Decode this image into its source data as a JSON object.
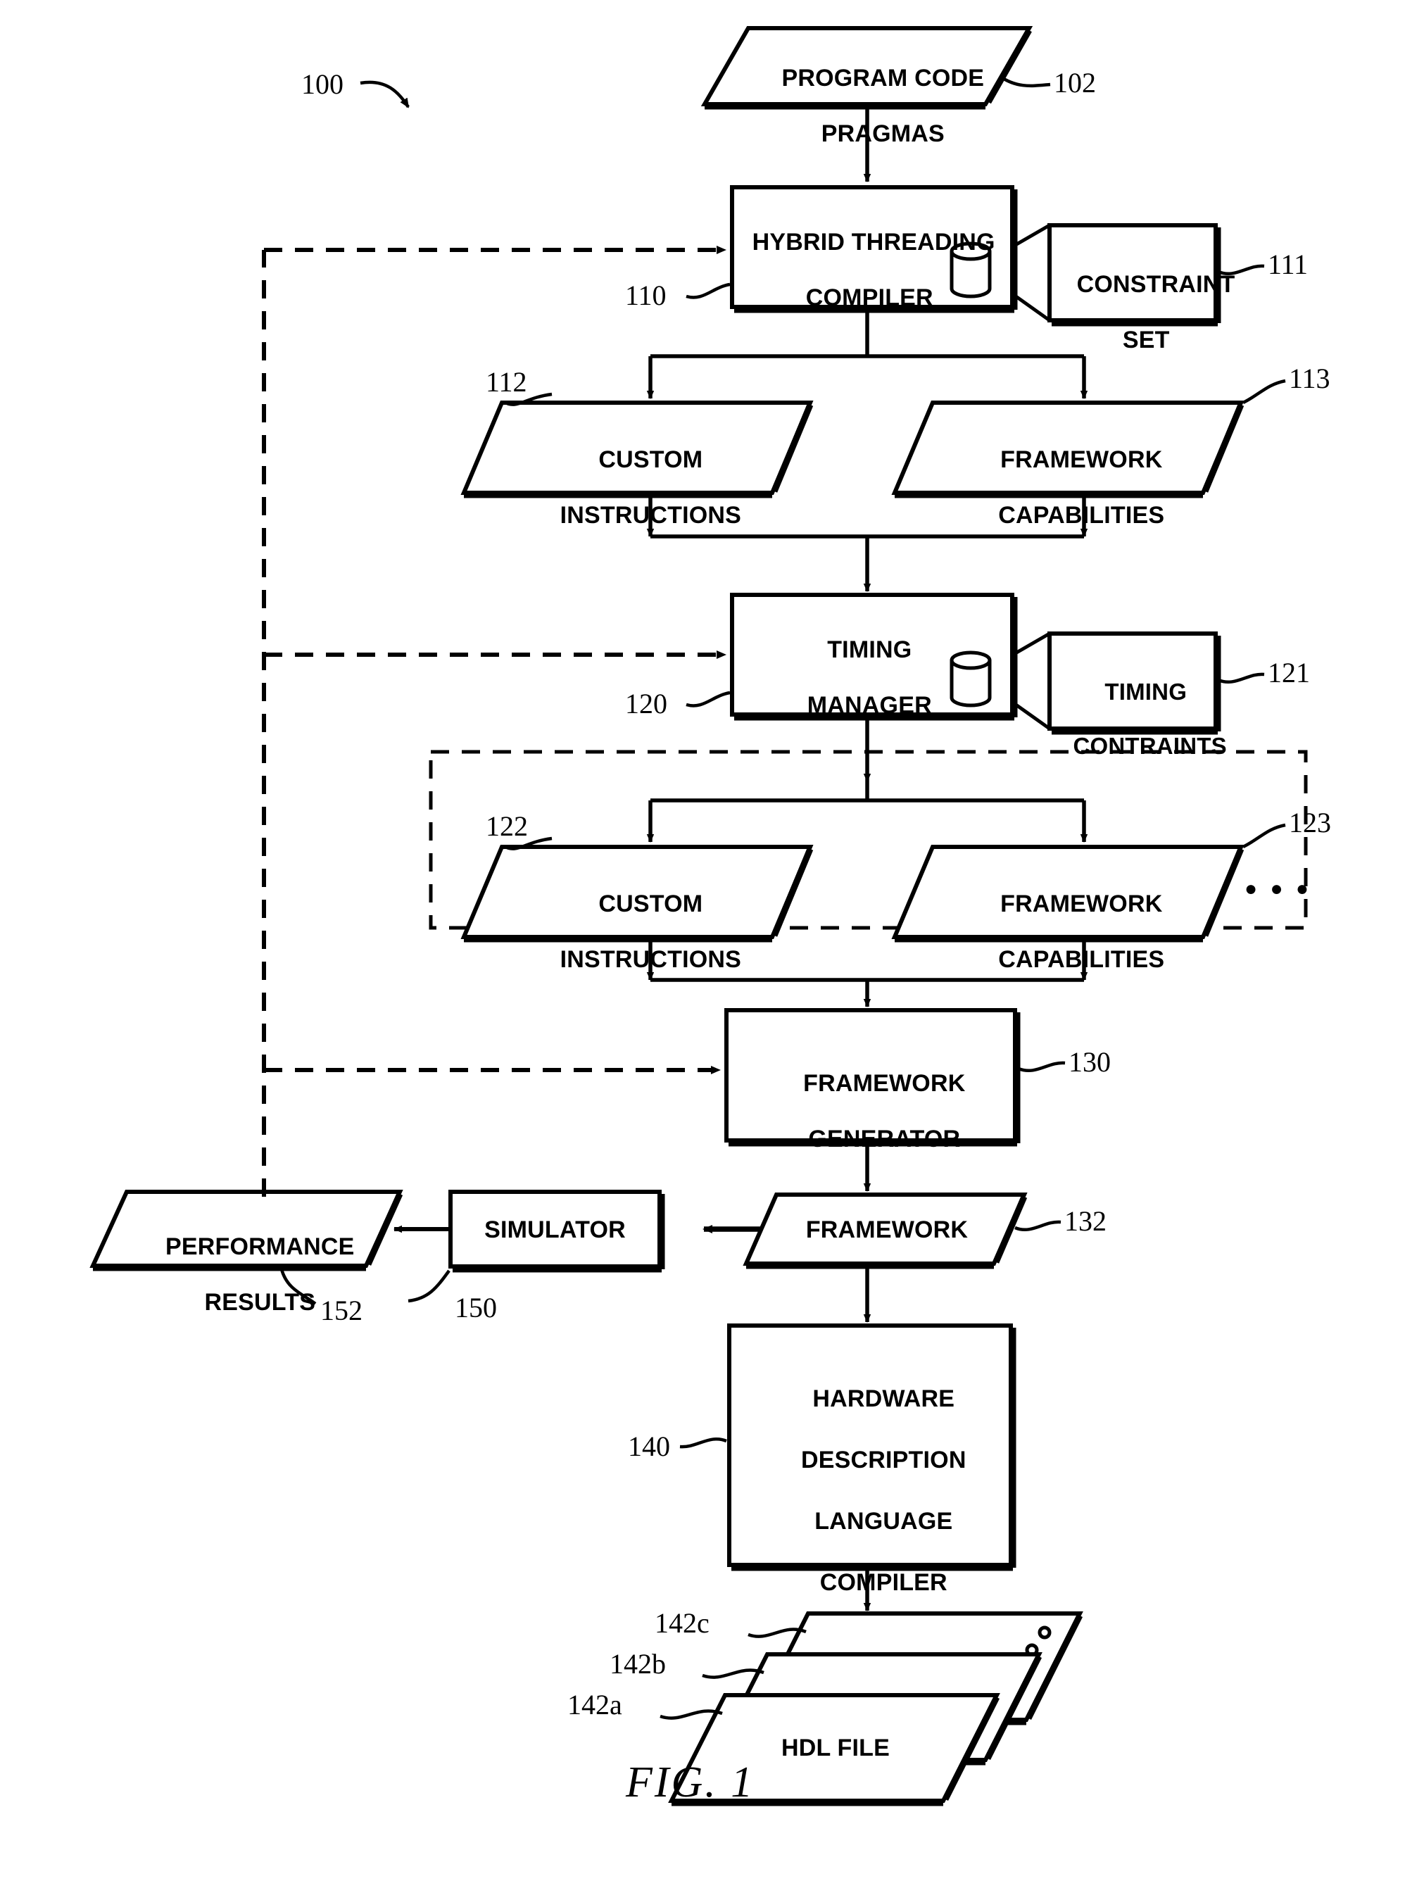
{
  "figure": {
    "caption": "FIG. 1",
    "system_ref": "100"
  },
  "nodes": {
    "program_code_pragmas": {
      "line1": "PROGRAM CODE",
      "line2": "PRAGMAS",
      "ref": "102",
      "shape": "parallelogram"
    },
    "hybrid_threading_compiler": {
      "line1": "HYBRID THREADING",
      "line2": "COMPILER",
      "ref": "110",
      "shape": "process",
      "icon": "database-cylinder-icon"
    },
    "constraint_set": {
      "line1": "CONSTRAINT",
      "line2": "SET",
      "ref": "111",
      "shape": "rect"
    },
    "custom_instructions_1": {
      "line1": "CUSTOM",
      "line2": "INSTRUCTIONS",
      "ref": "112",
      "shape": "parallelogram"
    },
    "framework_capabilities_1": {
      "line1": "FRAMEWORK",
      "line2": "CAPABILITIES",
      "ref": "113",
      "shape": "parallelogram"
    },
    "timing_manager": {
      "line1": "TIMING",
      "line2": "MANAGER",
      "ref": "120",
      "shape": "process",
      "icon": "database-cylinder-icon"
    },
    "timing_constraints": {
      "line1": "TIMING",
      "line2": "CONTRAINTS",
      "ref": "121",
      "shape": "rect"
    },
    "custom_instructions_2": {
      "line1": "CUSTOM",
      "line2": "INSTRUCTIONS",
      "ref": "122",
      "shape": "parallelogram"
    },
    "framework_capabilities_2": {
      "line1": "FRAMEWORK",
      "line2": "CAPABILITIES",
      "ref": "123",
      "shape": "parallelogram"
    },
    "framework_generator": {
      "line1": "FRAMEWORK",
      "line2": "GENERATOR",
      "ref": "130",
      "shape": "process"
    },
    "framework": {
      "line1": "FRAMEWORK",
      "line2": "",
      "ref": "132",
      "shape": "parallelogram"
    },
    "simulator": {
      "line1": "SIMULATOR",
      "line2": "",
      "ref": "150",
      "shape": "process"
    },
    "performance_results": {
      "line1": "PERFORMANCE",
      "line2": "RESULTS",
      "ref": "152",
      "shape": "parallelogram"
    },
    "hdl_compiler": {
      "line1": "HARDWARE",
      "line2": "DESCRIPTION",
      "line3": "LANGUAGE",
      "line4": "COMPILER",
      "ref": "140",
      "shape": "process"
    },
    "hdl_file_front": {
      "line1": "HDL FILE",
      "ref": "142a",
      "shape": "parallelogram"
    },
    "hdl_file_middle": {
      "line1": "",
      "ref": "142b",
      "shape": "parallelogram"
    },
    "hdl_file_back": {
      "line1": "",
      "ref": "142c",
      "shape": "parallelogram"
    }
  },
  "annotations": {
    "repeat_ellipsis": "● ● ●",
    "stack_ellipsis": "○ ○ ○"
  },
  "colors": {
    "stroke": "#000000",
    "background": "#ffffff"
  }
}
